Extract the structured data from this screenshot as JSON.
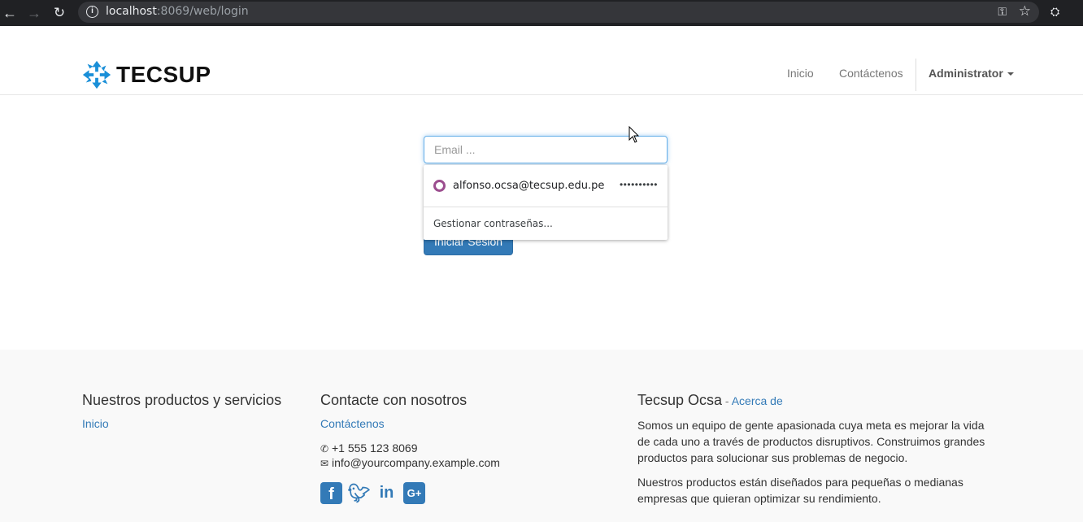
{
  "browser": {
    "url_host": "localhost",
    "url_rest": ":8069/web/login"
  },
  "header": {
    "brand": "TECSUP",
    "nav": {
      "home": "Inicio",
      "contact": "Contáctenos",
      "user": "Administrator"
    }
  },
  "login": {
    "email_placeholder": "Email ...",
    "submit_label": "Iniciar Sesión"
  },
  "autofill": {
    "username": "alfonso.ocsa@tecsup.edu.pe",
    "password_mask": "••••••••••",
    "manage_label": "Gestionar contraseñas..."
  },
  "footer": {
    "products": {
      "title": "Nuestros productos y servicios",
      "link": "Inicio"
    },
    "contact": {
      "title": "Contacte con nosotros",
      "link": "Contáctenos",
      "phone": "+1 555 123 8069",
      "email": "info@yourcompany.example.com"
    },
    "about": {
      "title": "Tecsup Ocsa",
      "separator": " - ",
      "about_link": "Acerca de",
      "p1": "Somos un equipo de gente apasionada cuya meta es mejorar la vida de cada uno a través de productos disruptivos. Construimos grandes productos para solucionar sus problemas de negocio.",
      "p2": "Nuestros productos están diseñados para pequeñas o medianas empresas que quieran optimizar su rendimiento."
    }
  },
  "colors": {
    "primary": "#337ab7",
    "autofill_ring": "#9c4e8f",
    "chrome_bg": "#202124"
  }
}
